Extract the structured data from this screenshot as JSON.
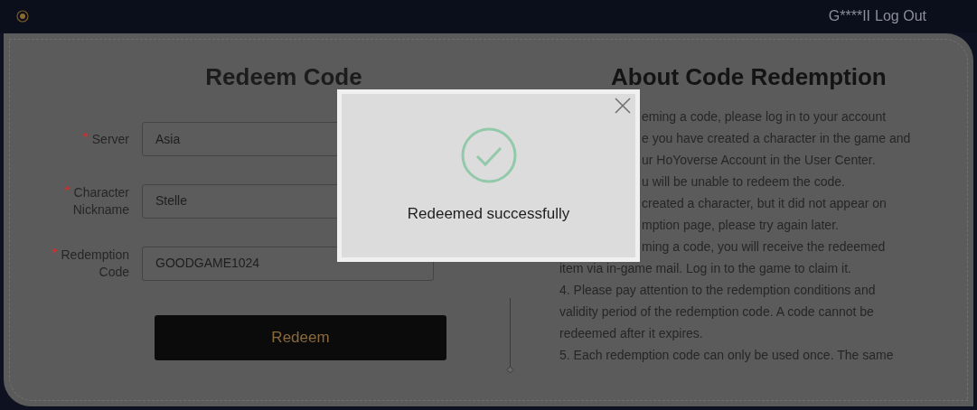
{
  "header": {
    "user": "G****II",
    "logout": "Log Out"
  },
  "form": {
    "title": "Redeem Code",
    "fields": [
      {
        "mark": "*",
        "label": [
          "Server"
        ],
        "value": "Asia"
      },
      {
        "mark": "*",
        "label": [
          "Character",
          "Nickname"
        ],
        "value": "Stelle"
      },
      {
        "mark": "*",
        "label": [
          "Redemption",
          "Code"
        ],
        "value": "GOODGAME1024"
      }
    ],
    "button": "Redeem"
  },
  "about": {
    "title": "About Code Redemption",
    "lines": [
      {
        "kind": "covered",
        "text": "eming a code, please log in to your account"
      },
      {
        "kind": "covered",
        "text": "e you have created a character in the game and"
      },
      {
        "kind": "covered",
        "text": "ur HoYoverse Account in the User Center."
      },
      {
        "kind": "covered",
        "text": "u will be unable to redeem the code."
      },
      {
        "kind": "covered",
        "text": "created a character, but it did not appear on"
      },
      {
        "kind": "covered",
        "text": "mption page, please try again later."
      },
      {
        "kind": "covered",
        "text": "ming a code, you will receive the redeemed"
      },
      {
        "kind": "full",
        "text": "item via in-game mail. Log in to the game to claim it."
      },
      {
        "kind": "full",
        "text": "4. Please pay attention to the redemption conditions and"
      },
      {
        "kind": "full",
        "text": "validity period of the redemption code. A code cannot be"
      },
      {
        "kind": "full",
        "text": "redeemed after it expires."
      },
      {
        "kind": "full",
        "text": "5. Each redemption code can only be used once. The same"
      }
    ]
  },
  "dialog": {
    "message": "Redeemed successfully"
  }
}
